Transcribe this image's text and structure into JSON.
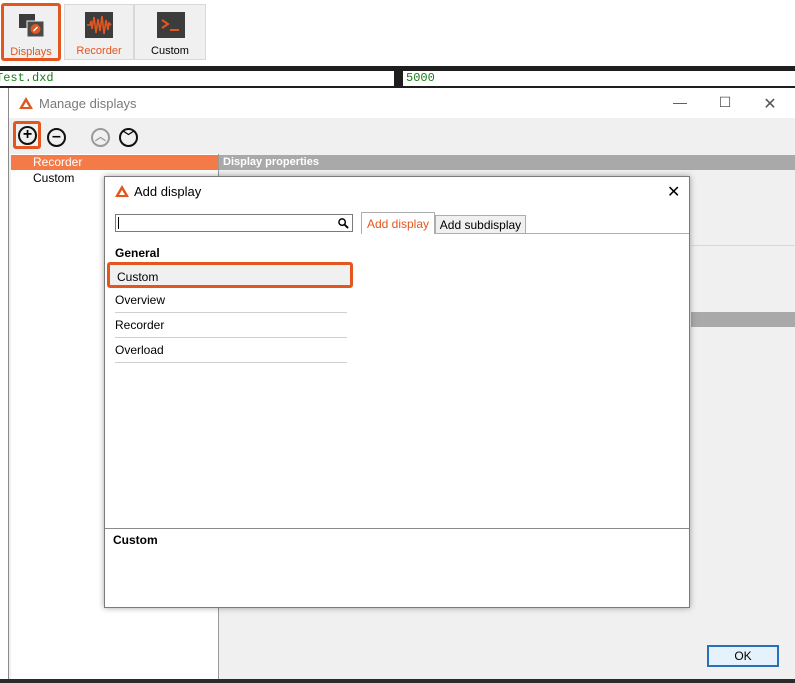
{
  "toolbar": {
    "displays_label": "Displays",
    "recorder_label": "Recorder",
    "custom_label": "Custom"
  },
  "path_bar": {
    "file_value": "Test.dxd",
    "rate_value": "5000"
  },
  "manage_window": {
    "title": "Manage displays",
    "tree_items": [
      "Recorder",
      "Custom"
    ],
    "properties_header": "Display properties",
    "ok_label": "OK"
  },
  "add_dialog": {
    "title": "Add display",
    "search_value": "",
    "tabs": [
      "Add display",
      "Add subdisplay"
    ],
    "group_header": "General",
    "items": [
      "Custom",
      "Overview",
      "Recorder",
      "Overload"
    ],
    "description_title": "Custom"
  },
  "colors": {
    "accent": "#e3561f",
    "selection": "#f47a48",
    "mono_text": "#1a7d1a"
  }
}
